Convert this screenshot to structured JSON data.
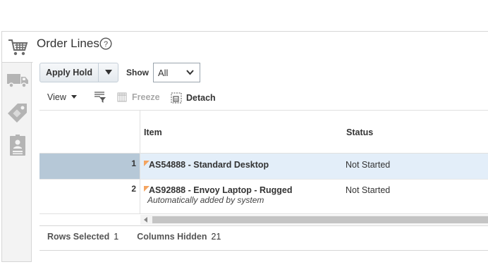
{
  "rail": {
    "tabs": [
      {
        "icon": "shopping-cart-icon",
        "active": true
      },
      {
        "icon": "truck-icon",
        "active": false
      },
      {
        "icon": "tag-icon",
        "active": false
      },
      {
        "icon": "id-badge-icon",
        "active": false
      }
    ]
  },
  "header": {
    "title": "Order Lines",
    "help_icon": "help-icon"
  },
  "toolbar": {
    "apply_hold_label": "Apply Hold",
    "show_label": "Show",
    "show_value": "All",
    "view_label": "View",
    "freeze_label": "Freeze",
    "detach_label": "Detach"
  },
  "table": {
    "columns": [
      "Item",
      "Status"
    ],
    "rows": [
      {
        "num": "1",
        "item": "AS54888 - Standard Desktop",
        "subtext": "",
        "status": "Not Started",
        "selected": true
      },
      {
        "num": "2",
        "item": "AS92888 - Envoy Laptop - Rugged",
        "subtext": "Automatically added by system",
        "status": "Not Started",
        "selected": false
      }
    ]
  },
  "footer": {
    "rows_selected_label": "Rows Selected",
    "rows_selected_value": "1",
    "columns_hidden_label": "Columns Hidden",
    "columns_hidden_value": "21"
  },
  "colors": {
    "selected_row_number_bg": "#b6c8d7",
    "selected_row_bg": "#e3eef9",
    "flag": "#f4a460"
  }
}
